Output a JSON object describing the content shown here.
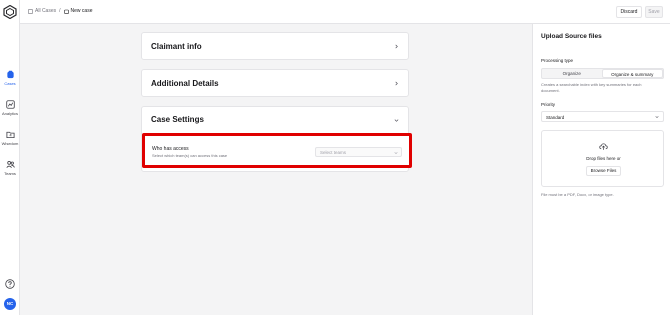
{
  "header": {
    "breadcrumb": {
      "parent": "All Cases",
      "current": "New case"
    },
    "discard_label": "Discard",
    "save_label": "Save"
  },
  "nav": {
    "items": [
      {
        "label": "Cases",
        "icon": "cases-icon",
        "active": true
      },
      {
        "label": "Analytics",
        "icon": "analytics-icon",
        "active": false
      },
      {
        "label": "Wisedom",
        "icon": "folder-icon",
        "active": false
      },
      {
        "label": "Teams",
        "icon": "teams-icon",
        "active": false
      }
    ],
    "avatar_initials": "NC"
  },
  "main": {
    "claimant_title": "Claimant info",
    "additional_title": "Additional Details",
    "settings_title": "Case Settings",
    "access": {
      "title": "Who has access",
      "description": "Select which team(s) can access this case",
      "select_placeholder": "Select teams"
    }
  },
  "upload": {
    "title": "Upload Source files",
    "processing_label": "Processing type",
    "options": [
      "Organize",
      "Organize & summary"
    ],
    "selected_option": "Organize & summary",
    "processing_description": "Creates a searchable index with key summaries for each document.",
    "priority_label": "Priority",
    "priority_value": "Standard",
    "drop_text": "Drop files here or",
    "browse_label": "Browse Files",
    "file_note": "File must be a PDF, Docx, or image type."
  },
  "colors": {
    "accent": "#2563eb",
    "highlight_border": "#e00000",
    "background": "#f4f4f5"
  }
}
